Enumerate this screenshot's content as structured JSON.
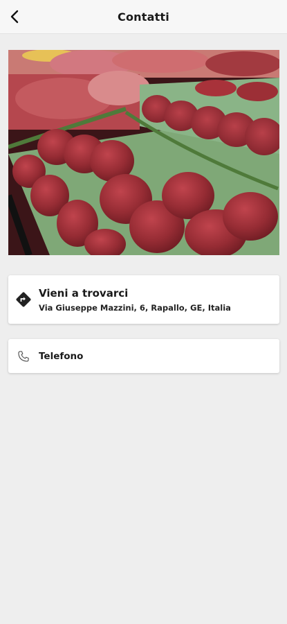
{
  "header": {
    "title": "Contatti",
    "back_icon": "chevron-left-icon"
  },
  "hero": {
    "subject": "butcher-counter-meat-photo"
  },
  "contacts": {
    "address": {
      "icon": "directions-icon",
      "title": "Vieni a trovarci",
      "subtitle": "Via Giuseppe Mazzini, 6, Rapallo, GE, Italia"
    },
    "phone": {
      "icon": "phone-icon",
      "label": "Telefono"
    }
  },
  "colors": {
    "background": "#eeeeee",
    "card": "#ffffff",
    "meat": "#8e2a30"
  }
}
